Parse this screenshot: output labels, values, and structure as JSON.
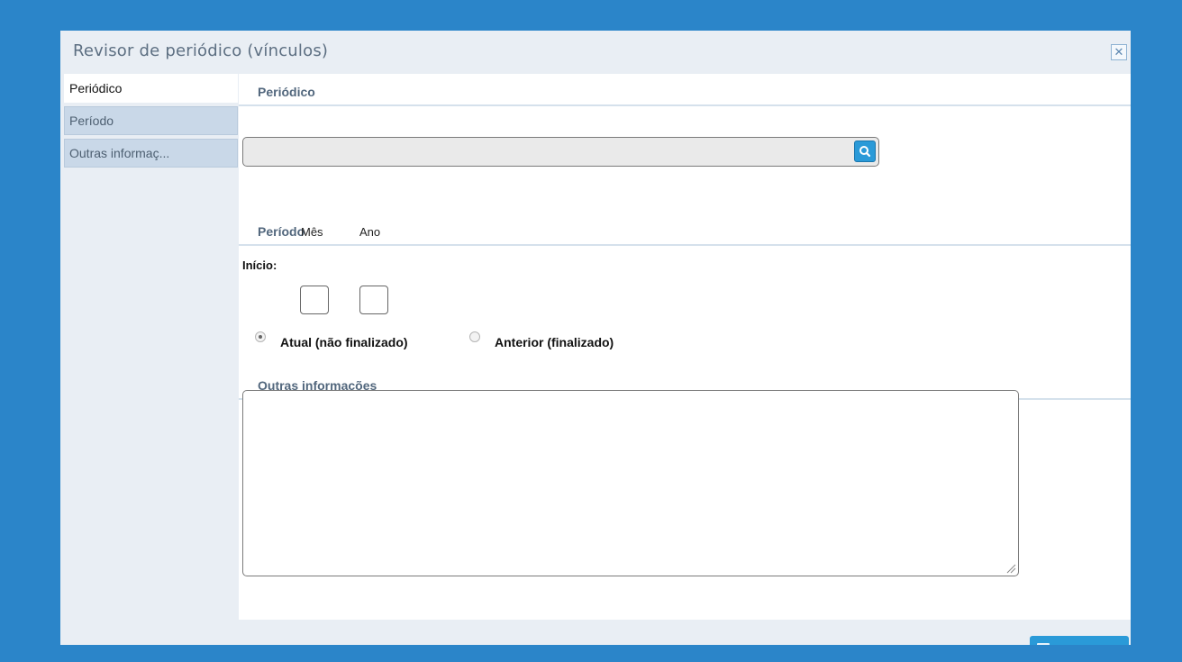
{
  "dialog": {
    "title": "Revisor de periódico (vínculos)",
    "close_icon": "close-icon"
  },
  "sidebar": {
    "tabs": [
      {
        "label": "Periódico",
        "active": true
      },
      {
        "label": "Período",
        "active": false
      },
      {
        "label": "Outras informaç...",
        "active": false
      }
    ]
  },
  "sections": {
    "periodico": {
      "header": "Periódico",
      "search_value": "",
      "search_icon": "search-icon"
    },
    "periodo": {
      "header": "Período",
      "inicio_label": "Início:",
      "mes_label": "Mês",
      "ano_label": "Ano",
      "mes_value": "",
      "ano_value": "",
      "radio_atual_label": "Atual (não finalizado)",
      "radio_anterior_label": "Anterior (finalizado)",
      "selected": "atual"
    },
    "outras": {
      "header": "Outras informações",
      "notes_value": ""
    }
  },
  "colors": {
    "background": "#2b85c9",
    "accent": "#2a9ad8",
    "tab_inactive": "#c9d8e8",
    "section_text": "#52677d"
  }
}
